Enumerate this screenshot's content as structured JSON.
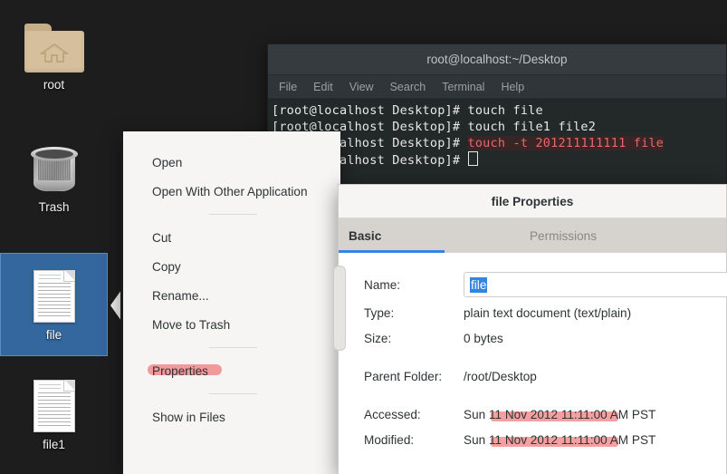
{
  "desktop": {
    "icons": [
      {
        "label": "root",
        "icon": "home-folder-icon",
        "selected": false
      },
      {
        "label": "Trash",
        "icon": "trash-can-icon",
        "selected": false
      },
      {
        "label": "file",
        "icon": "text-document-icon",
        "selected": true
      },
      {
        "label": "file1",
        "icon": "text-document-icon",
        "selected": false
      }
    ]
  },
  "terminal": {
    "title": "root@localhost:~/Desktop",
    "menu": [
      "File",
      "Edit",
      "View",
      "Search",
      "Terminal",
      "Help"
    ],
    "lines": [
      {
        "text": "[root@localhost Desktop]# touch file",
        "highlight": ""
      },
      {
        "text": "[root@localhost Desktop]# touch file1 file2",
        "highlight": ""
      },
      {
        "prompt": "[root@localhost Desktop]# ",
        "highlight": "touch -t 201211111111 file"
      },
      {
        "prompt": "[root@localhost Desktop]# ",
        "cursor": true
      }
    ]
  },
  "context_menu": {
    "items": [
      {
        "label": "Open",
        "highlighted": false
      },
      {
        "label": "Open With Other Application",
        "highlighted": false
      },
      {
        "separator": true
      },
      {
        "label": "Cut",
        "highlighted": false
      },
      {
        "label": "Copy",
        "highlighted": false
      },
      {
        "label": "Rename...",
        "highlighted": false
      },
      {
        "label": "Move to Trash",
        "highlighted": false
      },
      {
        "separator": true
      },
      {
        "label": "Properties",
        "highlighted": true
      },
      {
        "separator": true
      },
      {
        "label": "Show in Files",
        "highlighted": false
      }
    ],
    "open_label": "Open",
    "open_with_label": "Open With Other Application",
    "cut_label": "Cut",
    "copy_label": "Copy",
    "rename_label": "Rename...",
    "move_to_trash_label": "Move to Trash",
    "properties_label": "Properties",
    "show_in_files_label": "Show in Files"
  },
  "properties": {
    "title": "file Properties",
    "tabs": {
      "basic": "Basic",
      "permissions": "Permissions"
    },
    "active_tab": "Basic",
    "fields": {
      "name_label": "Name:",
      "name_value": "file",
      "type_label": "Type:",
      "type_value": "plain text document (text/plain)",
      "size_label": "Size:",
      "size_value": "0 bytes",
      "parent_label": "Parent Folder:",
      "parent_value": "/root/Desktop",
      "accessed_label": "Accessed:",
      "accessed_value": "Sun 11 Nov 2012 11:11:00 AM PST",
      "modified_label": "Modified:",
      "modified_value": "Sun 11 Nov 2012 11:11:00 AM PST"
    }
  },
  "colors": {
    "selection_blue": "#34679e",
    "accent_blue": "#3584e4",
    "annotation_red": "#f09a9a",
    "terminal_bg": "#232829",
    "terminal_chrome": "#353b3e",
    "menu_bg": "#f6f5f4",
    "desktop_bg": "#1d1d1d"
  }
}
